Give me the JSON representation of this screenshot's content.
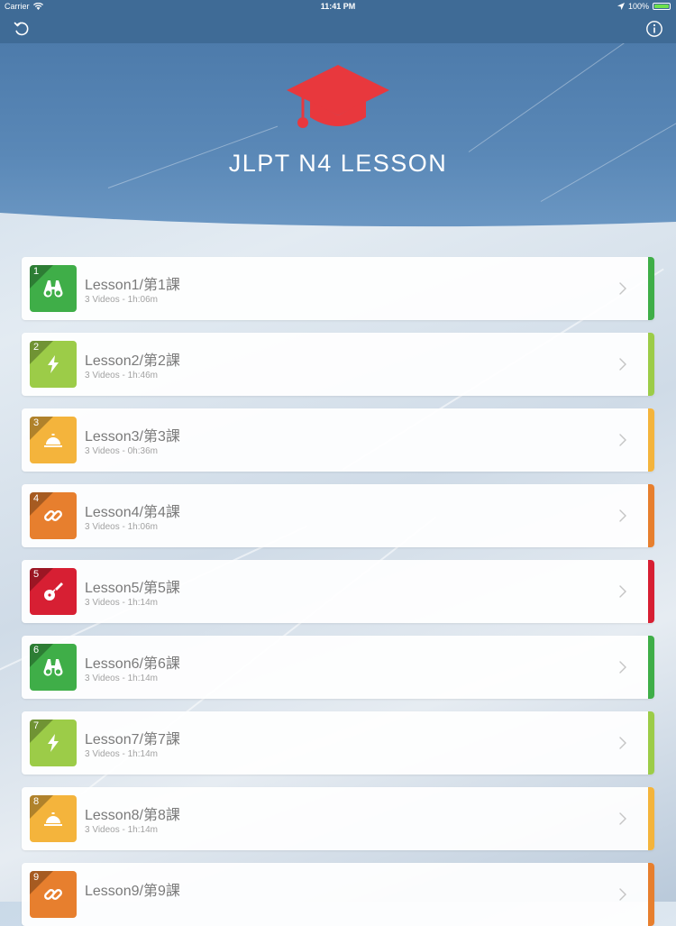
{
  "status_bar": {
    "carrier": "Carrier",
    "time": "11:41 PM",
    "battery": "100%"
  },
  "nav": {
    "left_icon": "refresh-icon",
    "right_icon": "info-icon"
  },
  "header": {
    "title": "JLPT N4 LESSON",
    "icon": "graduation-cap-icon",
    "icon_color": "#e8383d"
  },
  "lessons": [
    {
      "number": "1",
      "title": "Lesson1/第1課",
      "subtitle": "3 Videos - 1h:06m",
      "icon": "binoculars-icon",
      "color": "#3fae48"
    },
    {
      "number": "2",
      "title": "Lesson2/第2課",
      "subtitle": "3 Videos - 1h:46m",
      "icon": "lightning-icon",
      "color": "#9ccc48"
    },
    {
      "number": "3",
      "title": "Lesson3/第3課",
      "subtitle": "3 Videos - 0h:36m",
      "icon": "service-bell-icon",
      "color": "#f4b43c"
    },
    {
      "number": "4",
      "title": "Lesson4/第4課",
      "subtitle": "3 Videos - 1h:06m",
      "icon": "chain-link-icon",
      "color": "#e77f2e"
    },
    {
      "number": "5",
      "title": "Lesson5/第5課",
      "subtitle": "3 Videos - 1h:14m",
      "icon": "guitar-icon",
      "color": "#d71f33"
    },
    {
      "number": "6",
      "title": "Lesson6/第6課",
      "subtitle": "3 Videos - 1h:14m",
      "icon": "binoculars-icon",
      "color": "#3fae48"
    },
    {
      "number": "7",
      "title": "Lesson7/第7課",
      "subtitle": "3 Videos - 1h:14m",
      "icon": "lightning-icon",
      "color": "#9ccc48"
    },
    {
      "number": "8",
      "title": "Lesson8/第8課",
      "subtitle": "3 Videos - 1h:14m",
      "icon": "service-bell-icon",
      "color": "#f4b43c"
    },
    {
      "number": "9",
      "title": "Lesson9/第9課",
      "subtitle": "",
      "icon": "chain-link-icon",
      "color": "#e77f2e"
    }
  ]
}
